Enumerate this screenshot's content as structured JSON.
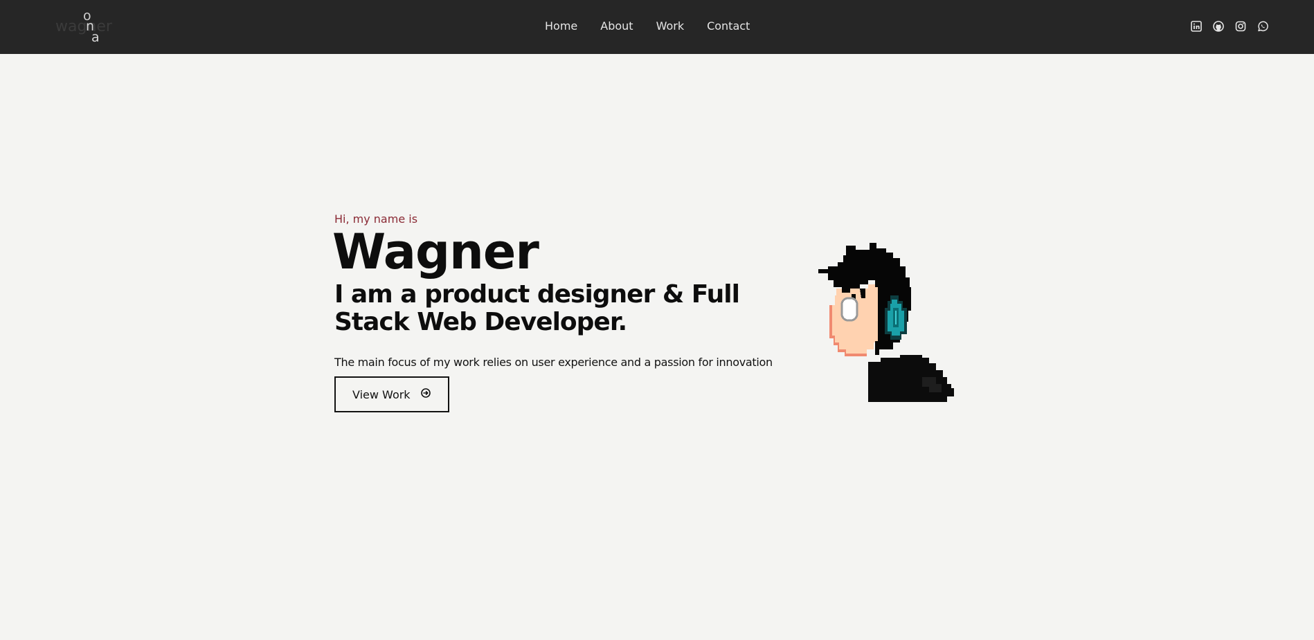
{
  "logo": {
    "text": "wagner",
    "stacked": [
      "o",
      "n",
      "a"
    ]
  },
  "nav": {
    "items": [
      "Home",
      "About",
      "Work",
      "Contact"
    ]
  },
  "social": [
    "linkedin-icon",
    "github-icon",
    "instagram-icon",
    "whatsapp-icon"
  ],
  "hero": {
    "greeting": "Hi, my name is",
    "name": "Wagner",
    "headline": "I am a product designer & Full Stack Web Developer.",
    "description": "The main focus of my work relies on user experience and a passion for innovation",
    "button_label": "View Work",
    "button_icon": "arrow-right-circle-icon"
  },
  "colors": {
    "navbar": "#262626",
    "background": "#f4f4f2",
    "accent": "#8a2a35",
    "headphone": "#1aa0a8"
  }
}
